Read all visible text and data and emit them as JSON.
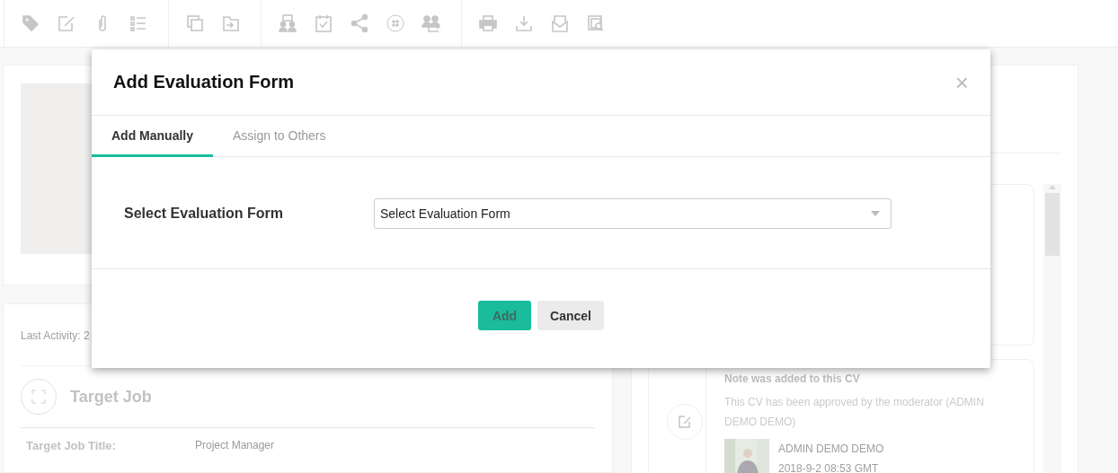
{
  "activity": {
    "last_activity": "Last Activity: 2"
  },
  "target_job": {
    "title": "Target Job",
    "fields": [
      {
        "label": "Target Job Title:",
        "value": "Project Manager"
      }
    ]
  },
  "timeline": [
    {
      "heading": "Note was added to this CV",
      "text": "This CV has been approved by the moderator (ADMIN DEMO DEMO)",
      "author": "ADMIN DEMO DEMO",
      "date": "2018-9-2 08:53 GMT"
    }
  ],
  "dialog": {
    "title": "Add Evaluation Form",
    "close": "×",
    "tabs": [
      {
        "label": "Add Manually",
        "selected": true
      },
      {
        "label": "Assign to Others",
        "selected": false
      }
    ],
    "field": {
      "label": "Select Evaluation Form",
      "value": "Select Evaluation Form"
    },
    "buttons": [
      {
        "label": "Add",
        "kind": "primary",
        "disabled": true
      },
      {
        "label": "Cancel",
        "kind": "secondary",
        "disabled": false
      }
    ]
  }
}
